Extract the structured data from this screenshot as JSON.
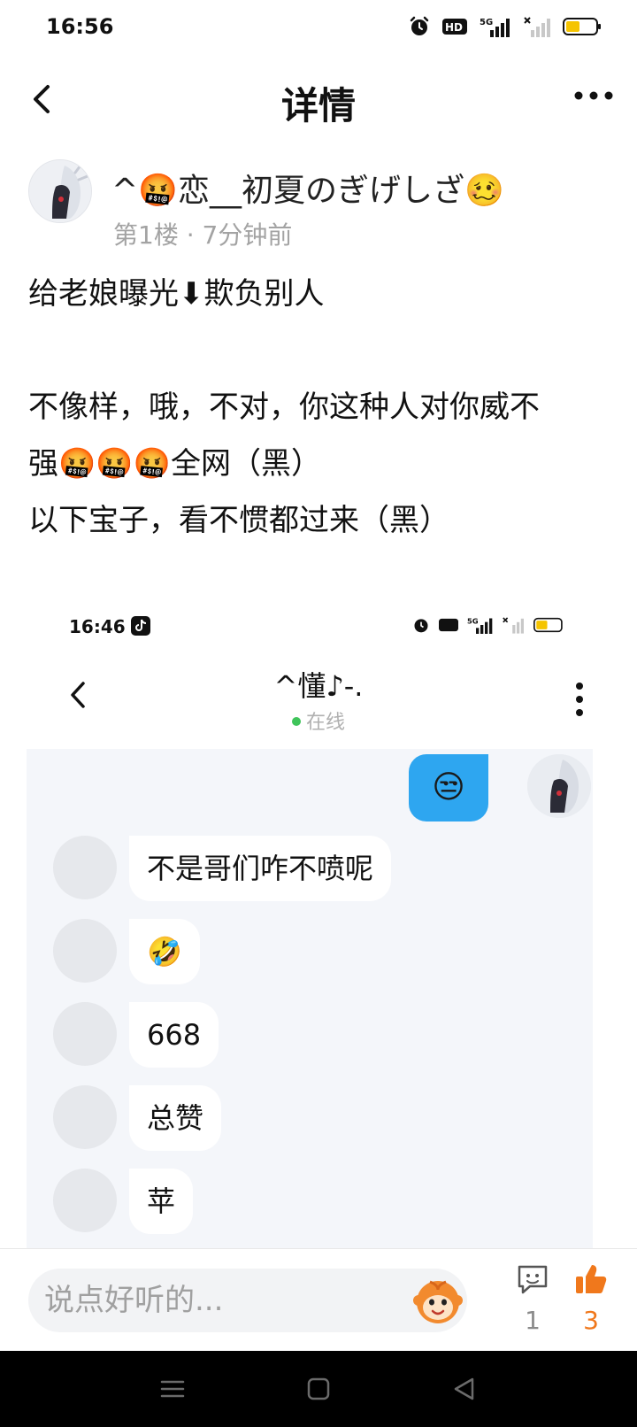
{
  "status_bar": {
    "time": "16:56",
    "icons": [
      "alarm-icon",
      "hd-icon",
      "5g-signal-icon",
      "no-signal-icon",
      "battery-icon"
    ],
    "hd_label": "HD",
    "network_label": "5G",
    "battery_color": "#f5c400"
  },
  "header": {
    "title": "详情",
    "back_icon": "chevron-left-icon",
    "more_icon": "more-dots-icon"
  },
  "post": {
    "username": "^🤬恋__初夏のぎげしざ🥴",
    "floor": "第1楼",
    "separator": "·",
    "time_ago": "7分钟前",
    "lines": [
      "给老娘曝光⬇欺负别人",
      "",
      "不像样，哦，不对，你这种人对你威不",
      "强🤬🤬🤬全网（黑）",
      "以下宝子，看不惯都过来（黑）"
    ]
  },
  "screenshot": {
    "status_time": "16:46",
    "network_label": "5G",
    "contact_name": "^懂♪-.",
    "online_status": "在线",
    "my_message": "😒",
    "messages": [
      "不是哥们咋不喷呢",
      "🤣",
      "668",
      "总赞",
      "苹"
    ]
  },
  "bottom_bar": {
    "comment_placeholder": "说点好听的...",
    "reply_count": "1",
    "like_count": "3",
    "accent_color": "#f0781c"
  },
  "system_nav": {
    "items": [
      "menu-icon",
      "home-icon",
      "back-triangle-icon"
    ]
  }
}
